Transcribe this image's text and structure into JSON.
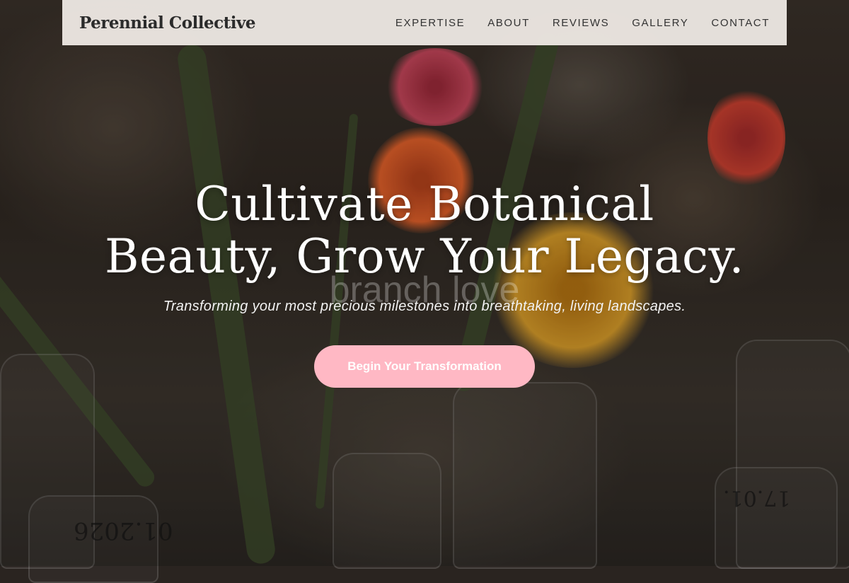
{
  "nav": {
    "brand": "Perennial Collective",
    "links": [
      "EXPERTISE",
      "ABOUT",
      "REVIEWS",
      "GALLERY",
      "CONTACT"
    ]
  },
  "hero": {
    "title_line1": "Cultivate Botanical",
    "title_line2": "Beauty, Grow Your Legacy.",
    "watermark": "branch love",
    "subtitle": "Transforming your most precious milestones into breathtaking, living landscapes.",
    "cta_label": "Begin Your Transformation",
    "glass_text_left": "01.2026",
    "glass_text_right": "17.01."
  },
  "colors": {
    "nav_bg": "#f0ebe6",
    "cta_bg": "#ffb8c4",
    "title": "#ffffff"
  }
}
